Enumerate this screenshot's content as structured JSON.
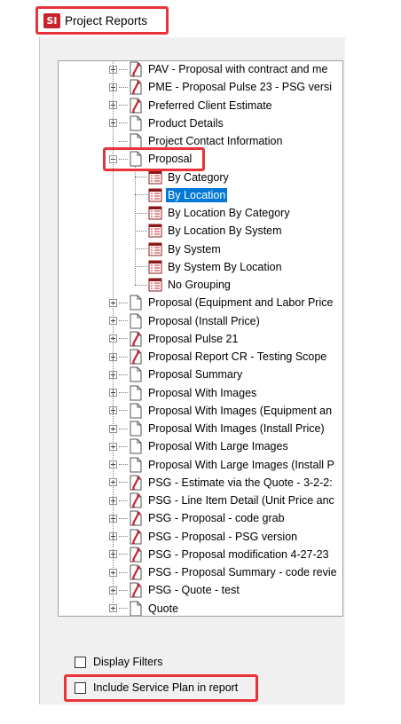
{
  "window": {
    "logo_text": "SI",
    "title": "Project Reports"
  },
  "tree": {
    "top_items": [
      {
        "label": "PAV - Proposal with contract and me",
        "icon": "report-red-icon",
        "expander": "plus"
      },
      {
        "label": "PME - Proposal Pulse 23 - PSG versi",
        "icon": "report-red-icon",
        "expander": "plus"
      },
      {
        "label": "Preferred Client Estimate",
        "icon": "report-red-icon",
        "expander": "plus"
      },
      {
        "label": "Product Details",
        "icon": "document-icon",
        "expander": "plus"
      },
      {
        "label": "Project Contact Information",
        "icon": "document-icon",
        "expander": "none"
      },
      {
        "label": "Proposal",
        "icon": "document-icon",
        "expander": "minus"
      }
    ],
    "children": [
      {
        "label": "By Category"
      },
      {
        "label": "By Location",
        "selected": true
      },
      {
        "label": "By Location By Category"
      },
      {
        "label": "By Location By System"
      },
      {
        "label": "By System"
      },
      {
        "label": "By System By Location"
      },
      {
        "label": "No Grouping"
      }
    ],
    "bottom_items": [
      {
        "label": "Proposal (Equipment and Labor Price",
        "icon": "document-icon"
      },
      {
        "label": "Proposal (Install Price)",
        "icon": "document-icon"
      },
      {
        "label": "Proposal Pulse 21",
        "icon": "report-red-icon"
      },
      {
        "label": "Proposal Report CR - Testing Scope",
        "icon": "report-red-icon"
      },
      {
        "label": "Proposal Summary",
        "icon": "document-icon"
      },
      {
        "label": "Proposal With Images",
        "icon": "document-icon"
      },
      {
        "label": "Proposal With Images (Equipment an",
        "icon": "document-icon"
      },
      {
        "label": "Proposal With Images (Install Price)",
        "icon": "document-icon"
      },
      {
        "label": "Proposal With Large Images",
        "icon": "document-icon"
      },
      {
        "label": "Proposal With Large Images (Install P",
        "icon": "document-icon"
      },
      {
        "label": "PSG - Estimate via the Quote - 3-2-2:",
        "icon": "report-red-icon"
      },
      {
        "label": "PSG - Line Item Detail (Unit Price anc",
        "icon": "report-red-icon"
      },
      {
        "label": "PSG - Proposal - code grab",
        "icon": "report-red-icon"
      },
      {
        "label": "PSG - Proposal - PSG version",
        "icon": "report-red-icon"
      },
      {
        "label": "PSG - Proposal modification 4-27-23",
        "icon": "report-red-icon"
      },
      {
        "label": "PSG - Proposal Summary - code revie",
        "icon": "report-red-icon"
      },
      {
        "label": "PSG - Quote - test",
        "icon": "report-red-icon"
      },
      {
        "label": "Quote",
        "icon": "document-icon"
      }
    ]
  },
  "options": {
    "display_filters": {
      "label": "Display Filters",
      "checked": false
    },
    "include_service_plan": {
      "label": "Include Service Plan in report",
      "checked": false
    }
  },
  "colors": {
    "highlight": "#e8333a",
    "selection": "#0078d7",
    "report_red": "#c8222b",
    "report_dark": "#8b1a1a"
  }
}
